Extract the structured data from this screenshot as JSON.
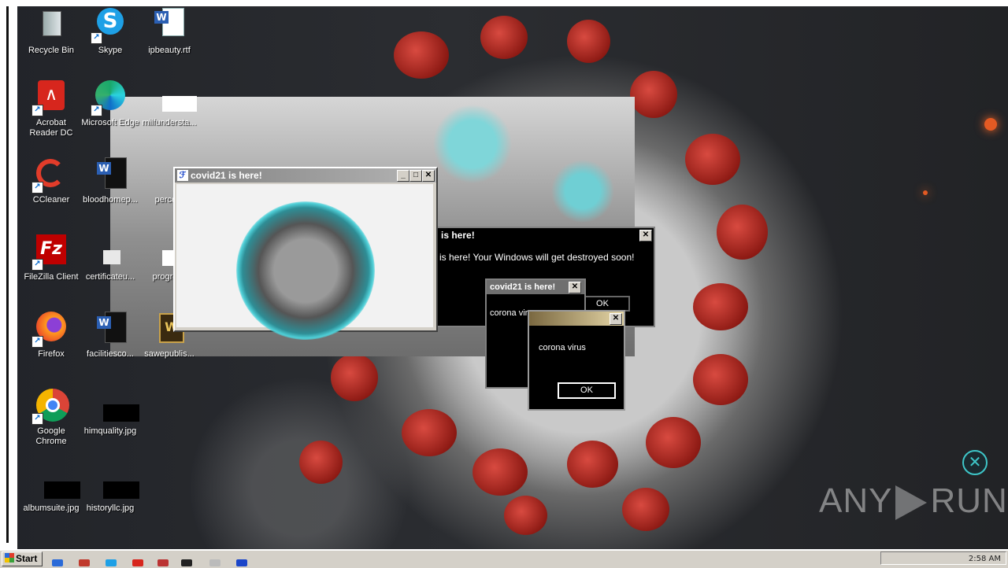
{
  "desktop_icons": [
    {
      "label": "Recycle Bin",
      "icon": "recycle-bin-icon"
    },
    {
      "label": "Skype",
      "icon": "skype-icon"
    },
    {
      "label": "ipbeauty.rtf",
      "icon": "word-document-icon"
    },
    {
      "label": "Acrobat Reader DC",
      "icon": "acrobat-icon"
    },
    {
      "label": "Microsoft Edge",
      "icon": "edge-icon"
    },
    {
      "label": "milfundersta...",
      "icon": "blank-file-icon"
    },
    {
      "label": "CCleaner",
      "icon": "ccleaner-icon"
    },
    {
      "label": "bloodhomep...",
      "icon": "word-document-icon"
    },
    {
      "label": "percent",
      "icon": "blank-file-icon"
    },
    {
      "label": "FileZilla Client",
      "icon": "filezilla-icon"
    },
    {
      "label": "certificateu...",
      "icon": "blank-file-icon"
    },
    {
      "label": "progress",
      "icon": "blank-file-icon"
    },
    {
      "label": "Firefox",
      "icon": "firefox-icon"
    },
    {
      "label": "facilitiesco...",
      "icon": "word-document-icon"
    },
    {
      "label": "sawepublis...",
      "icon": "wordperfect-icon"
    },
    {
      "label": "Google Chrome",
      "icon": "chrome-icon"
    },
    {
      "label": "himquality.jpg",
      "icon": "image-file-icon"
    },
    {
      "label": "albumsuite.jpg",
      "icon": "image-file-icon"
    },
    {
      "label": "historyllc.jpg",
      "icon": "image-file-icon"
    }
  ],
  "main_window": {
    "title": "covid21 is here!",
    "min": "_",
    "max": "□",
    "close": "✕"
  },
  "back_dialog": {
    "title": "is here!",
    "message": "is here! Your Windows will get destroyed soon!",
    "ok": "OK",
    "close": "✕"
  },
  "mid_dialog": {
    "title": "covid21 is here!",
    "message": "corona viru",
    "close": "✕"
  },
  "front_dialog": {
    "message": "corona virus",
    "ok": "OK",
    "close": "✕"
  },
  "watermark": {
    "brand": "ANY",
    "brand2": "RUN"
  },
  "taskbar": {
    "start_label": "Start",
    "clock": "2:58 AM"
  },
  "colors": {
    "accent": "#3ec6c8",
    "virus_red": "#b32a20",
    "dialog_bg": "#000000"
  }
}
